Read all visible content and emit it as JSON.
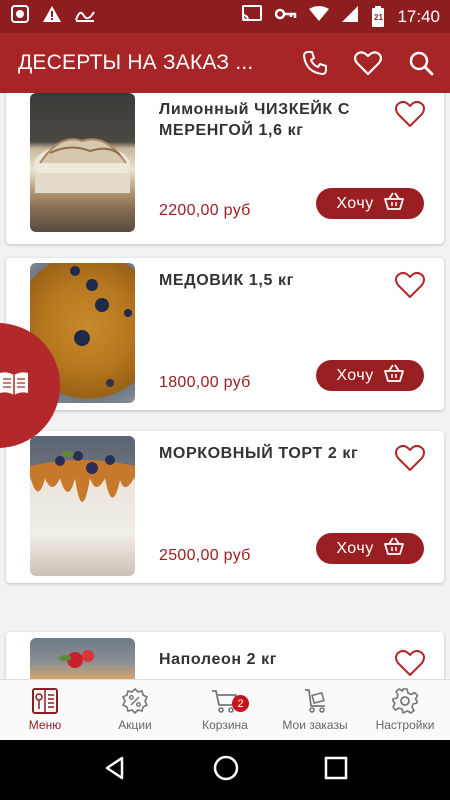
{
  "status_bar": {
    "time": "17:40",
    "battery_level": "21"
  },
  "app_bar": {
    "title": "ДЕСЕРТЫ НА ЗАКАЗ ..."
  },
  "products": [
    {
      "name": "Лимонный ЧИЗКЕЙК С МЕРЕНГОЙ 1,6 кг",
      "price": "2200,00 руб",
      "button_label": "Хочу"
    },
    {
      "name": "МЕДОВИК 1,5  кг",
      "price": "1800,00 руб",
      "button_label": "Хочу"
    },
    {
      "name": "МОРКОВНЫЙ ТОРТ 2 кг",
      "price": "2500,00 руб",
      "button_label": "Хочу"
    },
    {
      "name": "Наполеон 2 кг"
    }
  ],
  "bottom_nav": {
    "items": [
      {
        "label": "Меню",
        "icon": "menu-book-icon",
        "active": true
      },
      {
        "label": "Акции",
        "icon": "percent-badge-icon"
      },
      {
        "label": "Корзина",
        "icon": "cart-icon",
        "badge": "2"
      },
      {
        "label": "Мои заказы",
        "icon": "delivery-cart-icon"
      },
      {
        "label": "Настройки",
        "icon": "gear-icon"
      }
    ]
  },
  "colors": {
    "primary": "#a82527",
    "status_bar": "#8e1d1f",
    "accent": "#9a1f22",
    "background": "#f2f2f2"
  }
}
